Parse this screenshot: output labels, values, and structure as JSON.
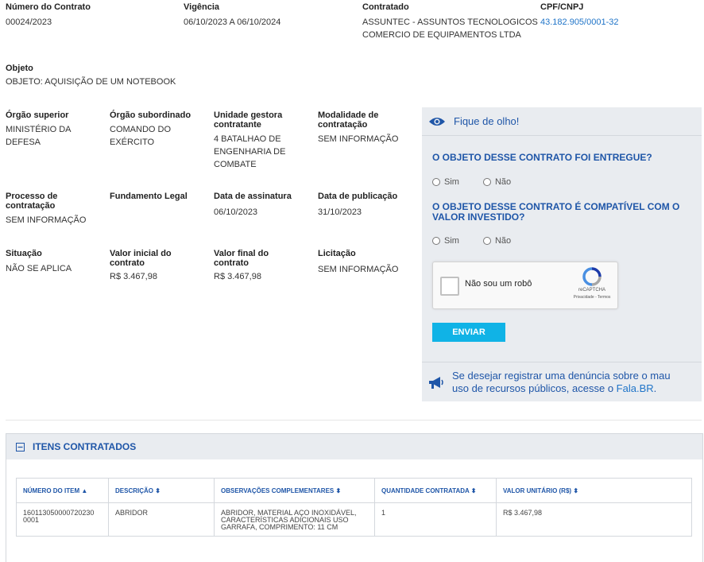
{
  "header": {
    "numero": {
      "label": "Número do Contrato",
      "value": "00024/2023"
    },
    "vigencia": {
      "label": "Vigência",
      "value": "06/10/2023 A 06/10/2024"
    },
    "contratado": {
      "label": "Contratado",
      "line1": "ASSUNTEC - ASSUNTOS TECNOLOGICOS",
      "line2": "COMERCIO DE EQUIPAMENTOS LTDA"
    },
    "cpf": {
      "label": "CPF/CNPJ",
      "value": "43.182.905/0001-32"
    }
  },
  "objeto": {
    "label": "Objeto",
    "value": "OBJETO: AQUISIÇÃO DE UM NOTEBOOK"
  },
  "fields": {
    "orgao_superior": {
      "label": "Órgão superior",
      "l1": "MINISTÉRIO DA",
      "l2": "DEFESA"
    },
    "orgao_subordinado": {
      "label": "Órgão subordinado",
      "l1": "COMANDO DO",
      "l2": "EXÉRCITO"
    },
    "unidade_gestora": {
      "l1": "Unidade gestora",
      "l2": "contratante",
      "v1": "4 BATALHAO DE",
      "v2": "ENGENHARIA DE",
      "v3": "COMBATE"
    },
    "modalidade": {
      "l1": "Modalidade de",
      "l2": "contratação",
      "value": "SEM INFORMAÇÃO"
    },
    "processo": {
      "l1": "Processo de",
      "l2": "contratação",
      "value": "SEM INFORMAÇÃO"
    },
    "fundamento": {
      "label": "Fundamento Legal"
    },
    "data_assinatura": {
      "label": "Data de assinatura",
      "value": "06/10/2023"
    },
    "data_publicacao": {
      "label": "Data de publicação",
      "value": "31/10/2023"
    },
    "situacao": {
      "label": "Situação",
      "value": "NÃO SE APLICA"
    },
    "valor_inicial": {
      "l1": "Valor inicial do",
      "l2": "contrato",
      "value": "R$ 3.467,98"
    },
    "valor_final": {
      "l1": "Valor final do",
      "l2": "contrato",
      "value": "R$ 3.467,98"
    },
    "licitacao": {
      "label": "Licitação",
      "value": "SEM INFORMAÇÃO"
    }
  },
  "panel": {
    "title": "Fique de olho!",
    "q1": "O OBJETO DESSE CONTRATO FOI ENTREGUE?",
    "q2_l1": "O OBJETO DESSE CONTRATO É COMPATÍVEL COM O",
    "q2_l2": "VALOR INVESTIDO?",
    "sim": "Sim",
    "nao": "Não",
    "captcha_label": "Não sou um robô",
    "captcha_brand": "reCAPTCHA",
    "captcha_links": "Privacidade - Termos",
    "submit": "ENVIAR",
    "footer_l1": "Se desejar registrar uma denúncia sobre o mau",
    "footer_l2_pre": "uso de recursos públicos, acesse o ",
    "footer_link": "Fala.BR",
    "footer_end": "."
  },
  "itens": {
    "title": "ITENS CONTRATADOS",
    "columns": [
      "NÚMERO DO ITEM",
      "DESCRIÇÃO",
      "OBSERVAÇÕES COMPLEMENTARES",
      "QUANTIDADE CONTRATADA",
      "VALOR UNITÁRIO (R$)"
    ],
    "row": {
      "numero_l1": "160113050000720230",
      "numero_l2": "0001",
      "descricao": "ABRIDOR",
      "obs_l1": "ABRIDOR, MATERIAL AÇO INOXIDÁVEL,",
      "obs_l2": "CARACTERÍSTICAS ADICIONAIS USO",
      "obs_l3": "GARRAFA, COMPRIMENTO: 11 CM",
      "quantidade": "1",
      "valor": "R$ 3.467,98"
    }
  },
  "colors": {
    "accent": "#1f56a8",
    "link": "#1f74c8",
    "button": "#10b3e6",
    "panel_bg": "#e9ecf0"
  }
}
